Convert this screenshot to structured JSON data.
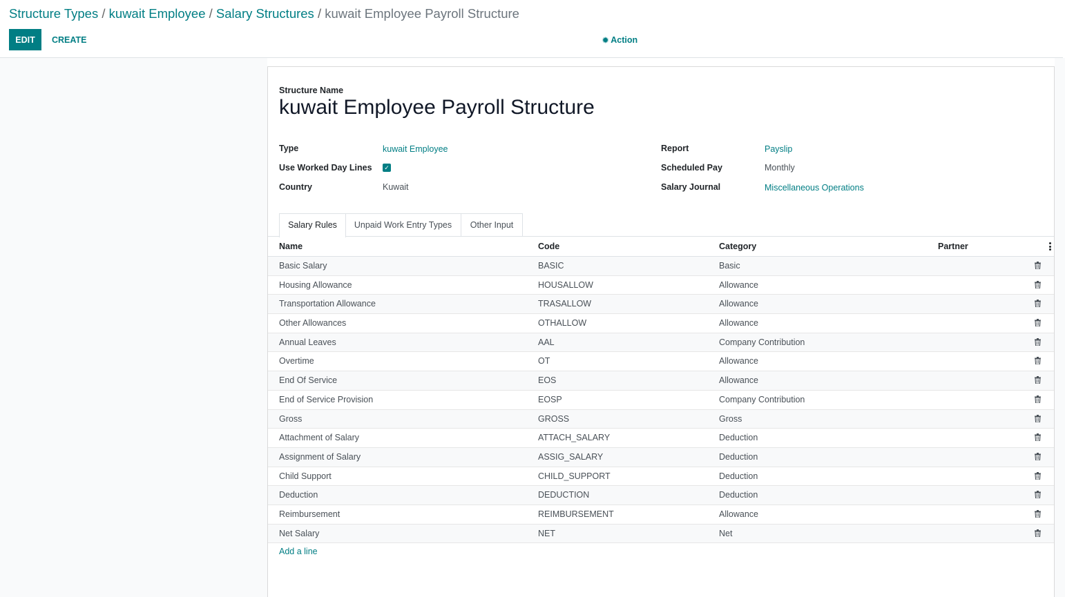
{
  "breadcrumb": {
    "items": [
      "Structure Types",
      "kuwait Employee",
      "Salary Structures"
    ],
    "active": "kuwait Employee Payroll Structure",
    "separator": "/"
  },
  "toolbar": {
    "edit_label": "EDIT",
    "create_label": "CREATE",
    "action_label": "Action",
    "action_icon": "gear-icon"
  },
  "form": {
    "structure_name_label": "Structure Name",
    "structure_name": "kuwait Employee Payroll Structure",
    "fields_left": {
      "type_label": "Type",
      "type_value": "kuwait Employee",
      "worked_day_lines_label": "Use Worked Day Lines",
      "worked_day_lines_checked": true,
      "country_label": "Country",
      "country_value": "Kuwait"
    },
    "fields_right": {
      "report_label": "Report",
      "report_value": "Payslip",
      "scheduled_pay_label": "Scheduled Pay",
      "scheduled_pay_value": "Monthly",
      "salary_journal_label": "Salary Journal",
      "salary_journal_value": "Miscellaneous Operations"
    }
  },
  "tabs": [
    "Salary Rules",
    "Unpaid Work Entry Types",
    "Other Input"
  ],
  "active_tab": "Salary Rules",
  "table": {
    "headers": [
      "Name",
      "Code",
      "Category",
      "Partner"
    ],
    "rows": [
      {
        "name": "Basic Salary",
        "code": "BASIC",
        "category": "Basic"
      },
      {
        "name": "Housing Allowance",
        "code": "HOUSALLOW",
        "category": "Allowance"
      },
      {
        "name": "Transportation Allowance",
        "code": "TRASALLOW",
        "category": "Allowance"
      },
      {
        "name": "Other Allowances",
        "code": "OTHALLOW",
        "category": "Allowance"
      },
      {
        "name": "Annual Leaves",
        "code": "AAL",
        "category": "Company Contribution"
      },
      {
        "name": "Overtime",
        "code": "OT",
        "category": "Allowance"
      },
      {
        "name": "End Of Service",
        "code": "EOS",
        "category": "Allowance"
      },
      {
        "name": "End of Service Provision",
        "code": "EOSP",
        "category": "Company Contribution"
      },
      {
        "name": "Gross",
        "code": "GROSS",
        "category": "Gross"
      },
      {
        "name": "Attachment of Salary",
        "code": "ATTACH_SALARY",
        "category": "Deduction"
      },
      {
        "name": "Assignment of Salary",
        "code": "ASSIG_SALARY",
        "category": "Deduction"
      },
      {
        "name": "Child Support",
        "code": "CHILD_SUPPORT",
        "category": "Deduction"
      },
      {
        "name": "Deduction",
        "code": "DEDUCTION",
        "category": "Deduction"
      },
      {
        "name": "Reimbursement",
        "code": "REIMBURSEMENT",
        "category": "Allowance"
      },
      {
        "name": "Net Salary",
        "code": "NET",
        "category": "Net"
      }
    ],
    "add_line_label": "Add a line"
  },
  "colors": {
    "accent": "#017e84",
    "muted_text": "#6c757d"
  }
}
